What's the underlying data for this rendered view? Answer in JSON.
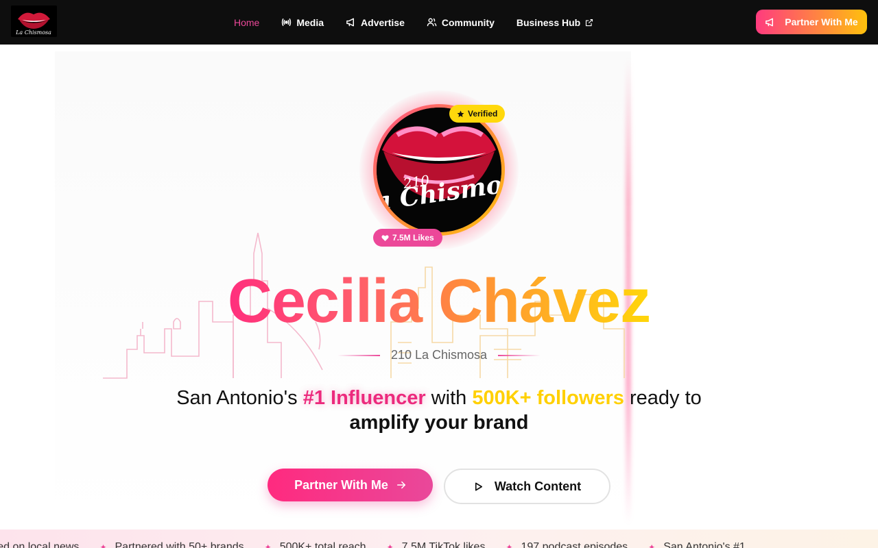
{
  "nav": {
    "logo_alt": "210 La Chismosa",
    "links": [
      {
        "label": "Home",
        "icon": "none",
        "active": true
      },
      {
        "label": "Media",
        "icon": "broadcast-icon"
      },
      {
        "label": "Advertise",
        "icon": "megaphone-icon"
      },
      {
        "label": "Community",
        "icon": "users-icon"
      },
      {
        "label": "Business Hub",
        "icon": "external-link-icon"
      }
    ],
    "cta_label": "Partner With Me"
  },
  "hero": {
    "badge_verified": "Verified",
    "badge_likes": "7.5M Likes",
    "name": "Cecilia Chávez",
    "subtitle": "210 La Chismosa",
    "tagline": {
      "part1": "San Antonio's ",
      "highlight1": "#1 Influencer",
      "part2": " with ",
      "highlight2": "500K+ followers",
      "part3": " ready to ",
      "highlight3": "amplify your brand"
    },
    "primary_button": "Partner With Me",
    "secondary_button": "Watch Content"
  },
  "ticker": {
    "items": [
      "Featured on local news",
      "Partnered with 50+ brands",
      "500K+ total reach",
      "7.5M TikTok likes",
      "197 podcast episodes",
      "San Antonio's #1"
    ]
  },
  "colors": {
    "pink": "#ec4899",
    "orange": "#ff8a3d",
    "yellow": "#ffd80c",
    "nav_bg": "#0e0e0e"
  }
}
